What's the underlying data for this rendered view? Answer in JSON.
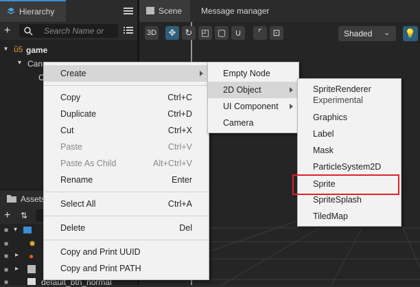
{
  "hierarchy": {
    "tab_label": "Hierarchy",
    "search_placeholder": "Search Name or",
    "nodes": [
      "game",
      "Can",
      "C"
    ]
  },
  "scene": {
    "tab_scene": "Scene",
    "tab_message": "Message manager",
    "mode_3d": "3D",
    "shading_select": "Shaded"
  },
  "assets": {
    "tab_label": "Assets",
    "items": [
      "default_btn_normal"
    ]
  },
  "context_menu": {
    "items": [
      {
        "label": "Create",
        "shortcut": ""
      },
      {
        "label": "Copy",
        "shortcut": "Ctrl+C"
      },
      {
        "label": "Duplicate",
        "shortcut": "Ctrl+D"
      },
      {
        "label": "Cut",
        "shortcut": "Ctrl+X"
      },
      {
        "label": "Paste",
        "shortcut": "Ctrl+V"
      },
      {
        "label": "Paste As Child",
        "shortcut": "Alt+Ctrl+V"
      },
      {
        "label": "Rename",
        "shortcut": "Enter"
      },
      {
        "label": "Select All",
        "shortcut": "Ctrl+A"
      },
      {
        "label": "Delete",
        "shortcut": "Del"
      },
      {
        "label": "Copy and Print UUID",
        "shortcut": ""
      },
      {
        "label": "Copy and Print PATH",
        "shortcut": ""
      }
    ]
  },
  "create_submenu": {
    "items": [
      "Empty Node",
      "2D Object",
      "UI Component",
      "Camera"
    ]
  },
  "object2d_submenu": {
    "items": [
      "SpriteRenderer",
      "Experimental",
      "Graphics",
      "Label",
      "Mask",
      "ParticleSystem2D",
      "Sprite",
      "SpriteSplash",
      "TiledMap"
    ]
  },
  "colors": {
    "highlight_box": "#e0202a",
    "menu_bg": "#f2f2f2",
    "accent": "#2f5d7a"
  }
}
